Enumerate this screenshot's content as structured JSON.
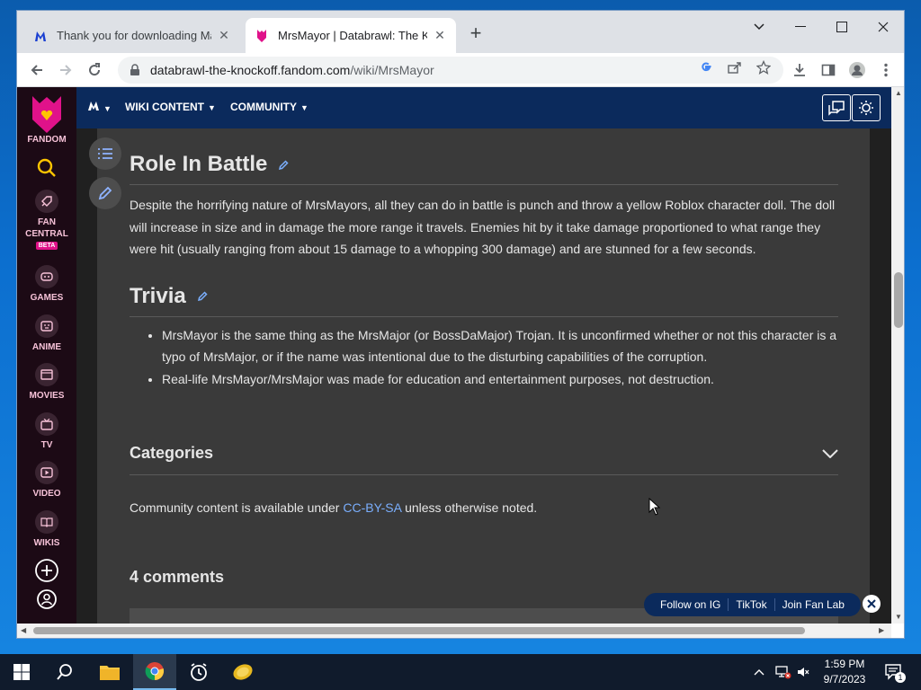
{
  "browser": {
    "tabs": [
      {
        "title": "Thank you for downloading Malwarebytes",
        "active": false
      },
      {
        "title": "MrsMayor | Databrawl: The Knockoff",
        "active": true
      }
    ],
    "url_domain": "databrawl-the-knockoff.fandom.com",
    "url_path": "/wiki/MrsMayor"
  },
  "fandom": {
    "logo_label": "FANDOM",
    "sidebar": [
      {
        "label": "FAN CENTRAL",
        "badge": "BETA"
      },
      {
        "label": "GAMES"
      },
      {
        "label": "ANIME"
      },
      {
        "label": "MOVIES"
      },
      {
        "label": "TV"
      },
      {
        "label": "VIDEO"
      },
      {
        "label": "WIKIS"
      }
    ],
    "nav": {
      "wiki_content": "WIKI CONTENT",
      "community": "COMMUNITY"
    }
  },
  "article": {
    "role_heading": "Role In Battle",
    "role_text": "Despite the horrifying nature of MrsMayors, all they can do in battle is punch and throw a yellow Roblox character doll. The doll will increase in size and in damage the more range it travels. Enemies hit by it take damage proportioned to what range they were hit (usually ranging from about 15 damage to a whopping 300 damage) and are stunned for a few seconds.",
    "trivia_heading": "Trivia",
    "trivia": [
      "MrsMayor is the same thing as the MrsMajor (or BossDaMajor) Trojan. It is unconfirmed whether or not this character is a typo of MrsMajor, or if the name was intentional due to the disturbing capabilities of the corruption.",
      "Real-life MrsMayor/MrsMajor was made for education and entertainment purposes, not destruction."
    ],
    "categories": "Categories",
    "license_prefix": "Community content is available under ",
    "license_link": "CC-BY-SA",
    "license_suffix": " unless otherwise noted.",
    "comments": "4 comments"
  },
  "follow_bar": {
    "links": [
      "Follow on IG",
      "TikTok",
      "Join Fan Lab"
    ]
  },
  "taskbar": {
    "time": "1:59 PM",
    "date": "9/7/2023",
    "notification_count": "1"
  },
  "colors": {
    "fandom_pink": "#e0128a",
    "nav_blue": "#0b2a5c",
    "link_blue": "#7aaefc",
    "content_bg": "#3a3a3a"
  }
}
